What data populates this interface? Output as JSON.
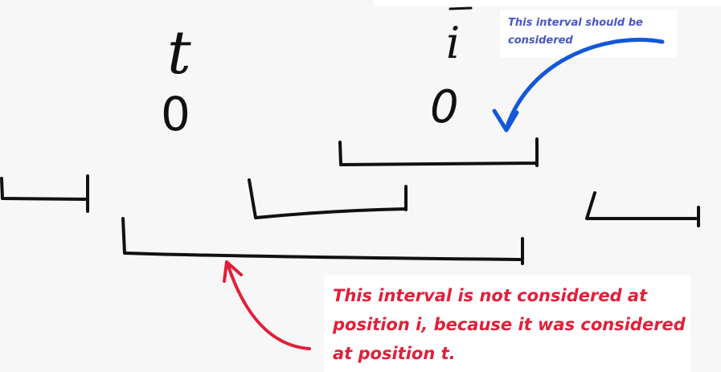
{
  "labels": {
    "t": "t",
    "i": "i",
    "zero_left": "0",
    "zero_right": "0"
  },
  "annotations": {
    "blue_note": "This interval should be considered",
    "red_note": "This interval is not considered at position i, because it was considered at position t."
  },
  "colors": {
    "ink": "#111111",
    "blue_arrow": "#1457d8",
    "blue_text": "#4a55c8",
    "red_arrow": "#e0203a",
    "red_text": "#e0203a"
  }
}
